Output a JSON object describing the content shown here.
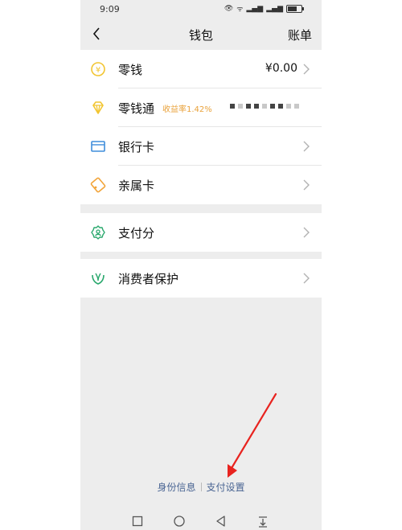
{
  "status_bar": {
    "time": "9:09"
  },
  "header": {
    "title": "钱包",
    "bill_label": "账单"
  },
  "wallet_items": [
    {
      "label": "零钱",
      "value": "¥0.00",
      "icon": "coin-icon"
    },
    {
      "label": "零钱通",
      "badge": "收益率1.42%",
      "icon": "diamond-icon"
    },
    {
      "label": "银行卡",
      "icon": "bank-card-icon"
    },
    {
      "label": "亲属卡",
      "icon": "family-card-icon"
    }
  ],
  "pay_score": {
    "label": "支付分",
    "icon": "pay-score-icon"
  },
  "consumer_protection": {
    "label": "消费者保护",
    "icon": "shield-hands-icon"
  },
  "footer": {
    "identity_info": "身份信息",
    "payment_settings": "支付设置"
  },
  "colors": {
    "accent_orange": "#e9a23b",
    "icon_yellow": "#f2c531",
    "icon_blue": "#3f8ddb",
    "icon_green": "#2aa86d",
    "link_blue": "#4a6593",
    "arrow_red": "#e8231f"
  }
}
